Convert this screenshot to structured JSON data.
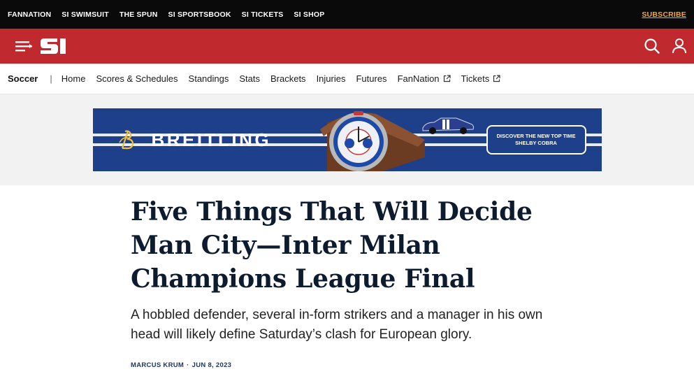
{
  "topbar": {
    "links": [
      "FANNATION",
      "SI SWIMSUIT",
      "THE SPUN",
      "SI SPORTSBOOK",
      "SI TICKETS",
      "SI SHOP"
    ],
    "subscribe": "SUBSCRIBE"
  },
  "header": {
    "logo_text": "SI",
    "brand_color": "#c0292d"
  },
  "section_nav": {
    "sport": "Soccer",
    "separator": "|",
    "items": [
      {
        "label": "Home",
        "external": false
      },
      {
        "label": "Scores & Schedules",
        "external": false
      },
      {
        "label": "Standings",
        "external": false
      },
      {
        "label": "Stats",
        "external": false
      },
      {
        "label": "Brackets",
        "external": false
      },
      {
        "label": "Injuries",
        "external": false
      },
      {
        "label": "Futures",
        "external": false
      },
      {
        "label": "FanNation",
        "external": true
      },
      {
        "label": "Tickets",
        "external": true
      }
    ]
  },
  "ad": {
    "brand": "BREITLING",
    "cta": "DISCOVER THE NEW TOP TIME SHELBY COBRA",
    "background": "#1e3f8a"
  },
  "article": {
    "headline": "Five Things That Will Decide Man City—Inter Milan Champions League Final",
    "dek": "A hobbled defender, several in-form strikers and a manager in his own head will likely define Saturday’s clash for European glory.",
    "author": "MARCUS KRUM",
    "date": "JUN 8, 2023"
  },
  "icons": [
    "menu-icon",
    "si-logo",
    "search-icon",
    "user-icon",
    "external-link-icon",
    "breitling-logo-icon",
    "watch-image",
    "car-image"
  ]
}
